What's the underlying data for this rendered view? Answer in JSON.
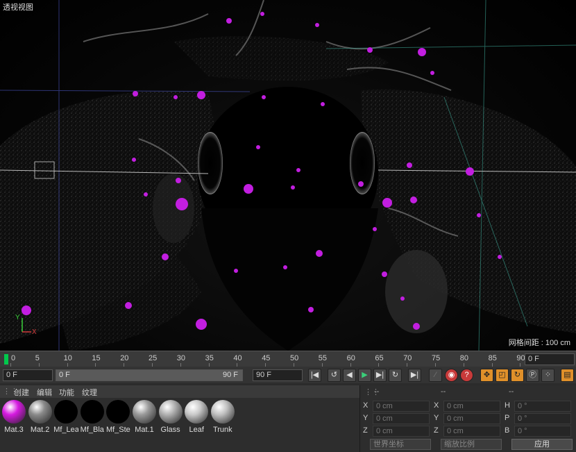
{
  "viewport": {
    "title": "透视视图",
    "grid_spacing": "网格间距 : 100 cm",
    "axis_x": "X",
    "axis_y": "Y"
  },
  "timeline": {
    "ticks": [
      "0",
      "5",
      "10",
      "15",
      "20",
      "25",
      "30",
      "35",
      "40",
      "45",
      "50",
      "55",
      "60",
      "65",
      "70",
      "75",
      "80",
      "85",
      "90"
    ],
    "current_frame": "0 F"
  },
  "transport": {
    "start_frame": "0 F",
    "range_start": "0 F",
    "range_end": "90 F",
    "end_frame": "90 F"
  },
  "material_menu": [
    "创建",
    "编辑",
    "功能",
    "纹理"
  ],
  "materials": [
    {
      "label": "Mat.3",
      "color": "#d51ae0"
    },
    {
      "label": "Mat.2",
      "color": "#8a8a8a"
    },
    {
      "label": "Mf_Lea",
      "color": "#000000"
    },
    {
      "label": "Mf_Bla",
      "color": "#000000"
    },
    {
      "label": "Mf_Ste",
      "color": "#000000"
    },
    {
      "label": "Mat.1",
      "color": "#9a9a9a"
    },
    {
      "label": "Glass",
      "color": "#b0b0b0"
    },
    {
      "label": "Leaf",
      "color": "#c8c8c8"
    },
    {
      "label": "Trunk",
      "color": "#c0c0c0"
    }
  ],
  "attributes": {
    "headers": [
      "--",
      "--",
      "--"
    ],
    "rows": [
      {
        "a": "X",
        "av": "0 cm",
        "b": "X",
        "bv": "0 cm",
        "c": "H",
        "cv": "0 °"
      },
      {
        "a": "Y",
        "av": "0 cm",
        "b": "Y",
        "bv": "0 cm",
        "c": "P",
        "cv": "0 °"
      },
      {
        "a": "Z",
        "av": "0 cm",
        "b": "Z",
        "bv": "0 cm",
        "c": "B",
        "cv": "0 °"
      }
    ],
    "coord_mode": "世界坐标",
    "scale_mode": "缩放比例",
    "apply_label": "应用"
  },
  "colors": {
    "particle": "#c21ee0",
    "playhead": "#00c94c",
    "accent_orange": "#e0902a"
  }
}
